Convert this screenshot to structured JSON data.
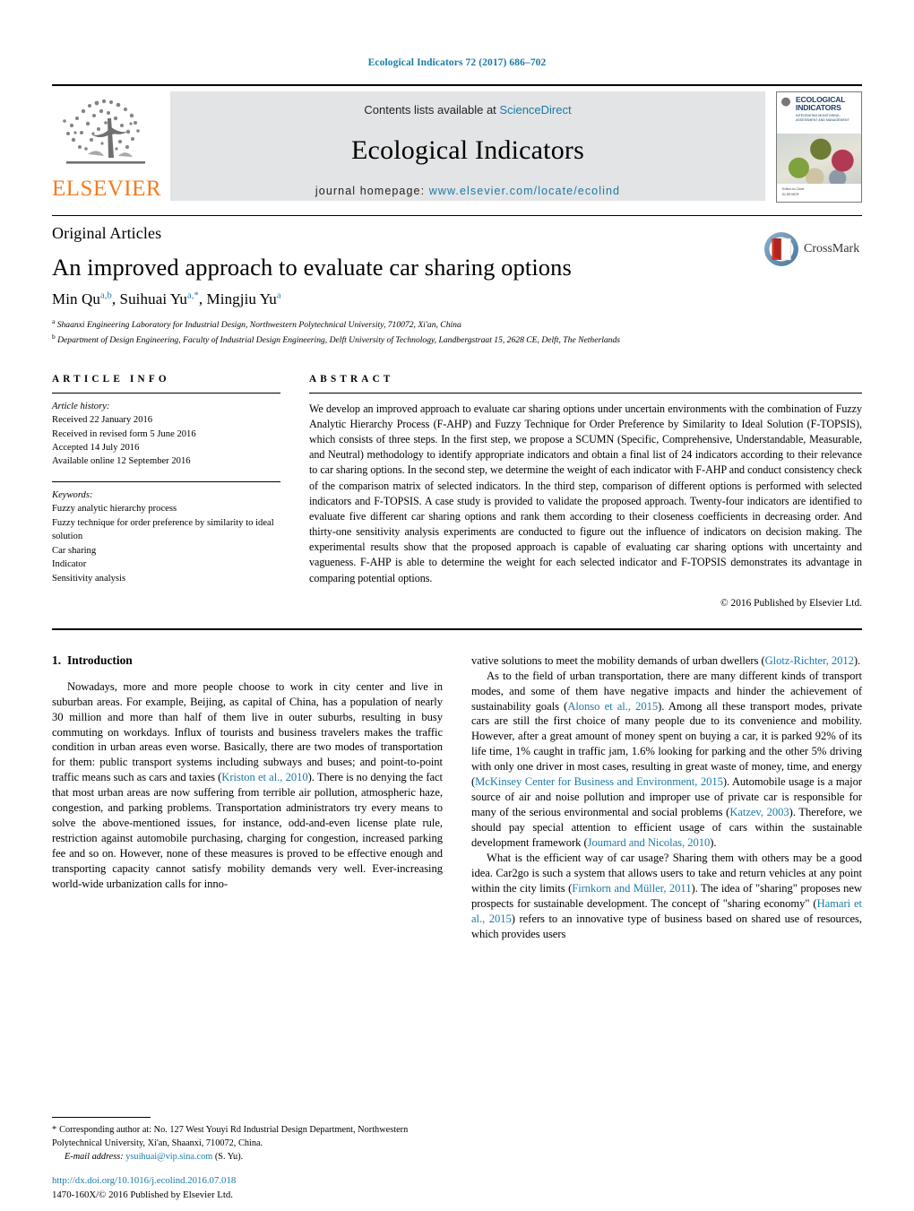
{
  "running_head": "Ecological Indicators 72 (2017) 686–702",
  "masthead": {
    "publisher_name": "ELSEVIER",
    "contents_prefix": "Contents lists available at ",
    "contents_link": "ScienceDirect",
    "journal_title": "Ecological Indicators",
    "homepage_prefix": "journal homepage: ",
    "homepage_url": "www.elsevier.com/locate/ecolind",
    "cover": {
      "title_line1": "ECOLOGICAL",
      "title_line2": "INDICATORS",
      "subtitle": "INTEGRATING MONITORING, ASSESSMENT AND MANAGEMENT",
      "footer_line1": "Editor-in-Chief",
      "footer_line2": "ELSEVIER"
    }
  },
  "article": {
    "section_label": "Original Articles",
    "title": "An improved approach to evaluate car sharing options",
    "crossmark_label": "CrossMark",
    "authors": [
      {
        "name": "Min Qu",
        "marks": "a,b"
      },
      {
        "name": "Suihuai Yu",
        "marks": "a,*"
      },
      {
        "name": "Mingjiu Yu",
        "marks": "a"
      }
    ],
    "affiliations": [
      {
        "mark": "a",
        "text": "Shaanxi Engineering Laboratory for Industrial Design, Northwestern Polytechnical University, 710072, Xi'an, China"
      },
      {
        "mark": "b",
        "text": "Department of Design Engineering, Faculty of Industrial Design Engineering, Delft University of Technology, Landbergstraat 15, 2628 CE, Delft, The Netherlands"
      }
    ]
  },
  "article_info": {
    "heading": "ARTICLE INFO",
    "history_label": "Article history:",
    "history": [
      "Received 22 January 2016",
      "Received in revised form 5 June 2016",
      "Accepted 14 July 2016",
      "Available online 12 September 2016"
    ],
    "keywords_label": "Keywords:",
    "keywords": [
      "Fuzzy analytic hierarchy process",
      "Fuzzy technique for order preference by similarity to ideal solution",
      "Car sharing",
      "Indicator",
      "Sensitivity analysis"
    ]
  },
  "abstract": {
    "heading": "ABSTRACT",
    "text": "We develop an improved approach to evaluate car sharing options under uncertain environments with the combination of Fuzzy Analytic Hierarchy Process (F-AHP) and Fuzzy Technique for Order Preference by Similarity to Ideal Solution (F-TOPSIS), which consists of three steps. In the first step, we propose a SCUMN (Specific, Comprehensive, Understandable, Measurable, and Neutral) methodology to identify appropriate indicators and obtain a final list of 24 indicators according to their relevance to car sharing options. In the second step, we determine the weight of each indicator with F-AHP and conduct consistency check of the comparison matrix of selected indicators. In the third step, comparison of different options is performed with selected indicators and F-TOPSIS. A case study is provided to validate the proposed approach. Twenty-four indicators are identified to evaluate five different car sharing options and rank them according to their closeness coefficients in decreasing order. And thirty-one sensitivity analysis experiments are conducted to figure out the influence of indicators on decision making. The experimental results show that the proposed approach is capable of evaluating car sharing options with uncertainty and vagueness. F-AHP is able to determine the weight for each selected indicator and F-TOPSIS demonstrates its advantage in comparing potential options.",
    "copyright": "© 2016 Published by Elsevier Ltd."
  },
  "body": {
    "intro_number": "1.",
    "intro_title": "Introduction",
    "left_paragraph_1": {
      "a": "Nowadays, more and more people choose to work in city center and live in suburban areas. For example, Beijing, as capital of China, has a population of nearly 30 million and more than half of them live in outer suburbs, resulting in busy commuting on workdays. Influx of tourists and business travelers makes the traffic condition in urban areas even worse. Basically, there are two modes of transportation for them: public transport systems including subways and buses; and point-to-point traffic means such as cars and taxies (",
      "ref1": "Kriston et al., 2010",
      "b": "). There is no denying the fact that most urban areas are now suffering from terrible air pollution, atmospheric haze, congestion, and parking problems. Transportation administrators try every means to solve the above-mentioned issues, for instance, odd-and-even license plate rule, restriction against automobile purchasing, charging for congestion, increased parking fee and so on. However, none of these measures is proved to be effective enough and transporting capacity cannot satisfy mobility demands very well. Ever-increasing world-wide urbanization calls for inno-"
    },
    "right_paragraph_1_cont": {
      "a": "vative solutions to meet the mobility demands of urban dwellers (",
      "ref1": "Glotz-Richter, 2012",
      "b": ")."
    },
    "right_paragraph_2": {
      "a": "As to the field of urban transportation, there are many different kinds of transport modes, and some of them have negative impacts and hinder the achievement of sustainability goals (",
      "ref1": "Alonso et al., 2015",
      "b": "). Among all these transport modes, private cars are still the first choice of many people due to its convenience and mobility. However, after a great amount of money spent on buying a car, it is parked 92% of its life time, 1% caught in traffic jam, 1.6% looking for parking and the other 5% driving with only one driver in most cases, resulting in great waste of money, time, and energy (",
      "ref2": "McKinsey Center for Business and Environment, 2015",
      "c": "). Automobile usage is a major source of air and noise pollution and improper use of private car is responsible for many of the serious environmental and social problems (",
      "ref3": "Katzev, 2003",
      "d": "). Therefore, we should pay special attention to efficient usage of cars within the sustainable development framework (",
      "ref4": "Joumard and Nicolas, 2010",
      "e": ")."
    },
    "right_paragraph_3": {
      "a": "What is the efficient way of car usage? Sharing them with others may be a good idea. Car2go is such a system that allows users to take and return vehicles at any point within the city limits (",
      "ref1": "Firnkorn and Müller, 2011",
      "b": "). The idea of \"sharing\" proposes new prospects for sustainable development. The concept of \"sharing economy\" (",
      "ref2": "Hamari et al., 2015",
      "c": ") refers to an innovative type of business based on shared use of resources, which provides users"
    }
  },
  "footnote": {
    "star": "*",
    "text": "Corresponding author at: No. 127 West Youyi Rd Industrial Design Department, Northwestern Polytechnical University, Xi'an, Shaanxi, 710072, China.",
    "email_label": "E-mail address:",
    "email": "ysuihuai@vip.sina.com",
    "email_suffix": "(S. Yu)."
  },
  "doi_block": {
    "doi": "http://dx.doi.org/10.1016/j.ecolind.2016.07.018",
    "issn_line": "1470-160X/© 2016 Published by Elsevier Ltd."
  },
  "colors": {
    "link": "#1a7aa8",
    "elsevier_orange": "#F47B20",
    "banner_bg": "#e3e4e5"
  }
}
